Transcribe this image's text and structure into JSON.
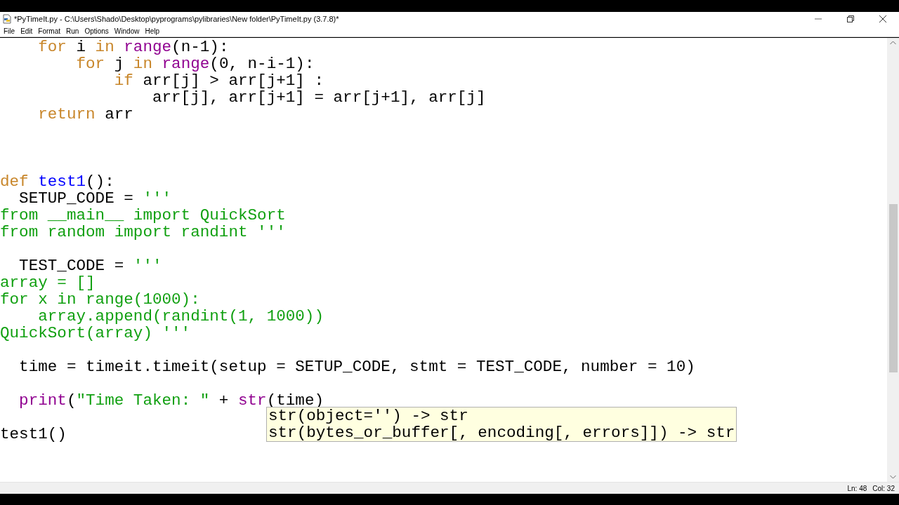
{
  "window": {
    "title": "*PyTimeIt.py - C:\\Users\\Shado\\Desktop\\pyprograms\\pylibraries\\New folder\\PyTimeIt.py (3.7.8)*"
  },
  "menu": [
    "File",
    "Edit",
    "Format",
    "Run",
    "Options",
    "Window",
    "Help"
  ],
  "lines": [
    {
      "kind": "code",
      "tokens": [
        {
          "kind": "keyword",
          "text": "    for"
        },
        {
          "kind": "plain",
          "text": " i "
        },
        {
          "kind": "keyword",
          "text": "in"
        },
        {
          "kind": "builtin",
          "text": " range"
        },
        {
          "kind": "plain",
          "text": "(n-1):"
        }
      ]
    },
    {
      "kind": "code",
      "tokens": [
        {
          "kind": "keyword",
          "text": "        for"
        },
        {
          "kind": "plain",
          "text": " j "
        },
        {
          "kind": "keyword",
          "text": "in"
        },
        {
          "kind": "builtin",
          "text": " range"
        },
        {
          "kind": "plain",
          "text": "(0, n-i-1):"
        }
      ]
    },
    {
      "kind": "code",
      "tokens": [
        {
          "kind": "keyword",
          "text": "            if"
        },
        {
          "kind": "plain",
          "text": " arr[j] > arr[j+1] :"
        }
      ]
    },
    {
      "kind": "code",
      "tokens": [
        {
          "kind": "plain",
          "text": "                arr[j], arr[j+1] = arr[j+1], arr[j]"
        }
      ]
    },
    {
      "kind": "code",
      "tokens": [
        {
          "kind": "keyword",
          "text": "    return"
        },
        {
          "kind": "plain",
          "text": " arr"
        }
      ]
    },
    {
      "kind": "blank"
    },
    {
      "kind": "blank"
    },
    {
      "kind": "blank"
    },
    {
      "kind": "code",
      "tokens": [
        {
          "kind": "keyword",
          "text": "def"
        },
        {
          "kind": "definition",
          "text": " test1"
        },
        {
          "kind": "plain",
          "text": "():"
        }
      ]
    },
    {
      "kind": "code",
      "tokens": [
        {
          "kind": "plain",
          "text": "  SETUP_CODE = "
        },
        {
          "kind": "string",
          "text": "'''"
        }
      ]
    },
    {
      "kind": "code",
      "tokens": [
        {
          "kind": "string",
          "text": "from __main__ import QuickSort"
        }
      ]
    },
    {
      "kind": "code",
      "tokens": [
        {
          "kind": "string",
          "text": "from random import randint '''"
        }
      ]
    },
    {
      "kind": "blank"
    },
    {
      "kind": "code",
      "tokens": [
        {
          "kind": "plain",
          "text": "  TEST_CODE = "
        },
        {
          "kind": "string",
          "text": "'''"
        }
      ]
    },
    {
      "kind": "code",
      "tokens": [
        {
          "kind": "string",
          "text": "array = []"
        }
      ]
    },
    {
      "kind": "code",
      "tokens": [
        {
          "kind": "string",
          "text": "for x in range(1000):"
        }
      ]
    },
    {
      "kind": "code",
      "tokens": [
        {
          "kind": "string",
          "text": "    array.append(randint(1, 1000))"
        }
      ]
    },
    {
      "kind": "code",
      "tokens": [
        {
          "kind": "string",
          "text": "QuickSort(array) '''"
        }
      ]
    },
    {
      "kind": "blank"
    },
    {
      "kind": "code",
      "tokens": [
        {
          "kind": "plain",
          "text": "  time = timeit.timeit(setup = SETUP_CODE, stmt = TEST_CODE, number = 10)"
        }
      ]
    },
    {
      "kind": "blank"
    },
    {
      "kind": "code",
      "tokens": [
        {
          "kind": "builtin",
          "text": "  print"
        },
        {
          "kind": "plain",
          "text": "("
        },
        {
          "kind": "string",
          "text": "\"Time Taken: \""
        },
        {
          "kind": "plain",
          "text": " + "
        },
        {
          "kind": "builtin",
          "text": "str"
        },
        {
          "kind": "plain",
          "text": "(time)"
        }
      ]
    },
    {
      "kind": "blank"
    },
    {
      "kind": "code",
      "tokens": [
        {
          "kind": "plain",
          "text": "test1()"
        }
      ]
    }
  ],
  "calltip": [
    "str(object='') -> str",
    "str(bytes_or_buffer[, encoding[, errors]]) -> str"
  ],
  "status_bar": {
    "line": "Ln: 48",
    "column": "Col: 32"
  }
}
